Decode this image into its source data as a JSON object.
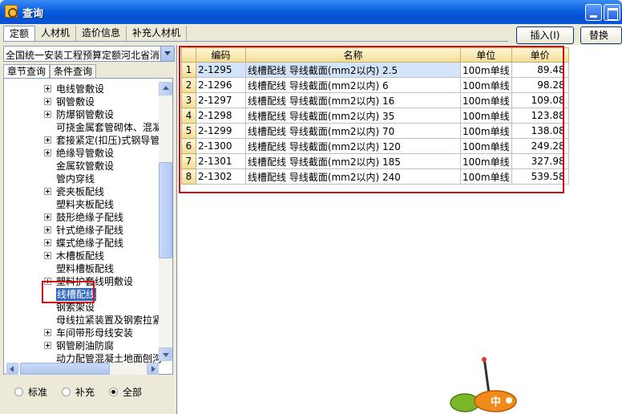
{
  "window": {
    "title": "查询"
  },
  "top_tabs": [
    "定额",
    "人材机",
    "造价信息",
    "补充人材机"
  ],
  "buttons": {
    "insert": "插入(I)",
    "replace": "替换(R)"
  },
  "combo": {
    "value": "全国统一安装工程预算定额河北省消"
  },
  "left_tabs": [
    "章节查询",
    "条件查询"
  ],
  "tree": {
    "items": [
      {
        "label": "电线管敷设",
        "expandable": true
      },
      {
        "label": "钢管敷设",
        "expandable": true
      },
      {
        "label": "防爆钢管敷设",
        "expandable": true
      },
      {
        "label": "可挠金属套管砌体、混凝",
        "expandable": false
      },
      {
        "label": "套接紧定(扣压)式钢导管",
        "expandable": true
      },
      {
        "label": "绝缘导管敷设",
        "expandable": true
      },
      {
        "label": "金属软管敷设",
        "expandable": false
      },
      {
        "label": "管内穿线",
        "expandable": false
      },
      {
        "label": "瓷夹板配线",
        "expandable": true
      },
      {
        "label": "塑料夹板配线",
        "expandable": false
      },
      {
        "label": "鼓形绝缘子配线",
        "expandable": true
      },
      {
        "label": "针式绝缘子配线",
        "expandable": true
      },
      {
        "label": "蝶式绝缘子配线",
        "expandable": true
      },
      {
        "label": "木槽板配线",
        "expandable": true
      },
      {
        "label": "塑料槽板配线",
        "expandable": false
      },
      {
        "label": "塑料护套线明敷设",
        "expandable": true
      },
      {
        "label": "线槽配线",
        "expandable": false,
        "selected": true
      },
      {
        "label": "钢索架设",
        "expandable": false
      },
      {
        "label": "母线拉紧装置及钢索拉紧",
        "expandable": false
      },
      {
        "label": "车间带形母线安装",
        "expandable": true
      },
      {
        "label": "钢管刷油防腐",
        "expandable": true
      },
      {
        "label": "动力配管混凝土地面刨沟",
        "expandable": false
      }
    ]
  },
  "filter": {
    "options": [
      "标准",
      "补充",
      "全部"
    ],
    "selected": "全部"
  },
  "grid": {
    "headers": [
      "编码",
      "名称",
      "单位",
      "单价"
    ],
    "rows": [
      {
        "no": "1",
        "code": "2-1295",
        "name": "线槽配线 导线截面(mm2以内) 2.5",
        "unit": "100m单线",
        "price": "89.48"
      },
      {
        "no": "2",
        "code": "2-1296",
        "name": "线槽配线 导线截面(mm2以内) 6",
        "unit": "100m单线",
        "price": "98.28"
      },
      {
        "no": "3",
        "code": "2-1297",
        "name": "线槽配线 导线截面(mm2以内) 16",
        "unit": "100m单线",
        "price": "109.08"
      },
      {
        "no": "4",
        "code": "2-1298",
        "name": "线槽配线 导线截面(mm2以内) 35",
        "unit": "100m单线",
        "price": "123.88"
      },
      {
        "no": "5",
        "code": "2-1299",
        "name": "线槽配线 导线截面(mm2以内) 70",
        "unit": "100m单线",
        "price": "138.08"
      },
      {
        "no": "6",
        "code": "2-1300",
        "name": "线槽配线 导线截面(mm2以内) 120",
        "unit": "100m单线",
        "price": "249.28"
      },
      {
        "no": "7",
        "code": "2-1301",
        "name": "线槽配线 导线截面(mm2以内) 185",
        "unit": "100m单线",
        "price": "327.98"
      },
      {
        "no": "8",
        "code": "2-1302",
        "name": "线槽配线 导线截面(mm2以内) 240",
        "unit": "100m单线",
        "price": "539.58"
      }
    ]
  },
  "mascot": {
    "label": "中"
  },
  "colors": {
    "highlight_frame": "#d01010",
    "selection": "#316ac5",
    "header_bg": "#f3dc92"
  }
}
